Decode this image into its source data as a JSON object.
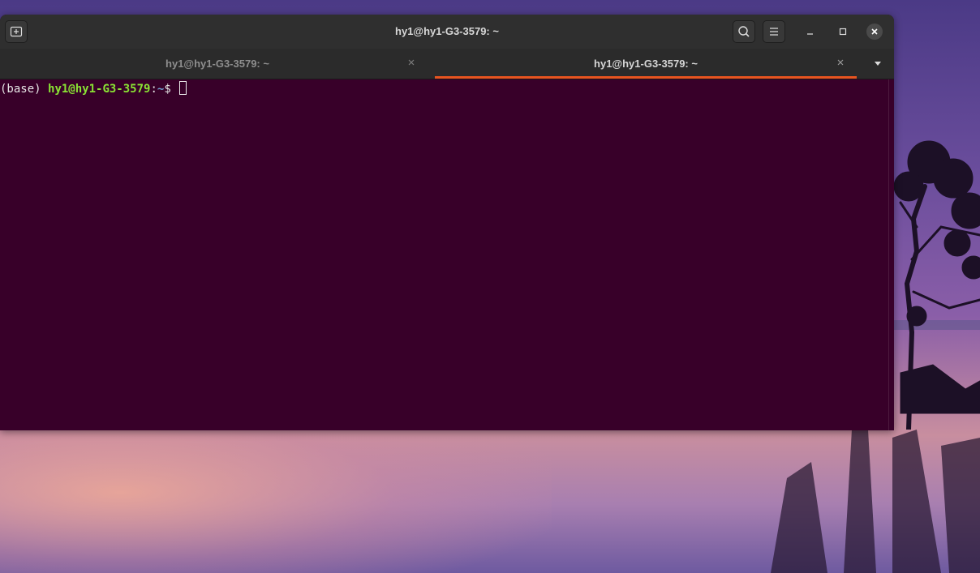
{
  "window": {
    "title": "hy1@hy1-G3-3579: ~"
  },
  "tabs": [
    {
      "label": "hy1@hy1-G3-3579: ~",
      "active": false
    },
    {
      "label": "hy1@hy1-G3-3579: ~",
      "active": true
    }
  ],
  "terminal": {
    "env": "(base)",
    "userhost": "hy1@hy1-G3-3579",
    "colon": ":",
    "path": "~",
    "prompt_symbol": "$"
  },
  "icons": {
    "new_tab": "new-tab-icon",
    "search": "search-icon",
    "menu": "hamburger-menu-icon",
    "minimize": "minimize-icon",
    "maximize": "maximize-icon",
    "close": "close-icon",
    "tab_close": "close-icon",
    "tab_menu": "chevron-down-icon"
  },
  "colors": {
    "terminal_bg": "#380029",
    "titlebar_bg": "#2f2f2f",
    "active_tab_accent": "#e95420",
    "prompt_user": "#8ae234",
    "prompt_path": "#729fcf"
  }
}
